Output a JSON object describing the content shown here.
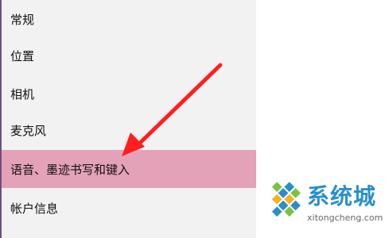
{
  "sidebar": {
    "items": [
      {
        "label": "常规"
      },
      {
        "label": "位置"
      },
      {
        "label": "相机"
      },
      {
        "label": "麦克风"
      },
      {
        "label": "语音、墨迹书写和键入"
      },
      {
        "label": "帐户信息"
      }
    ],
    "selected_index": 4
  },
  "colors": {
    "sidebar_bg": "#f2f2f2",
    "selected_bg": "#e3a2b8",
    "arrow": "#ff1f1f",
    "watermark_blue": "#2a8fc9"
  },
  "watermark": {
    "title": "系统城",
    "url": "xitongcheng.com"
  }
}
